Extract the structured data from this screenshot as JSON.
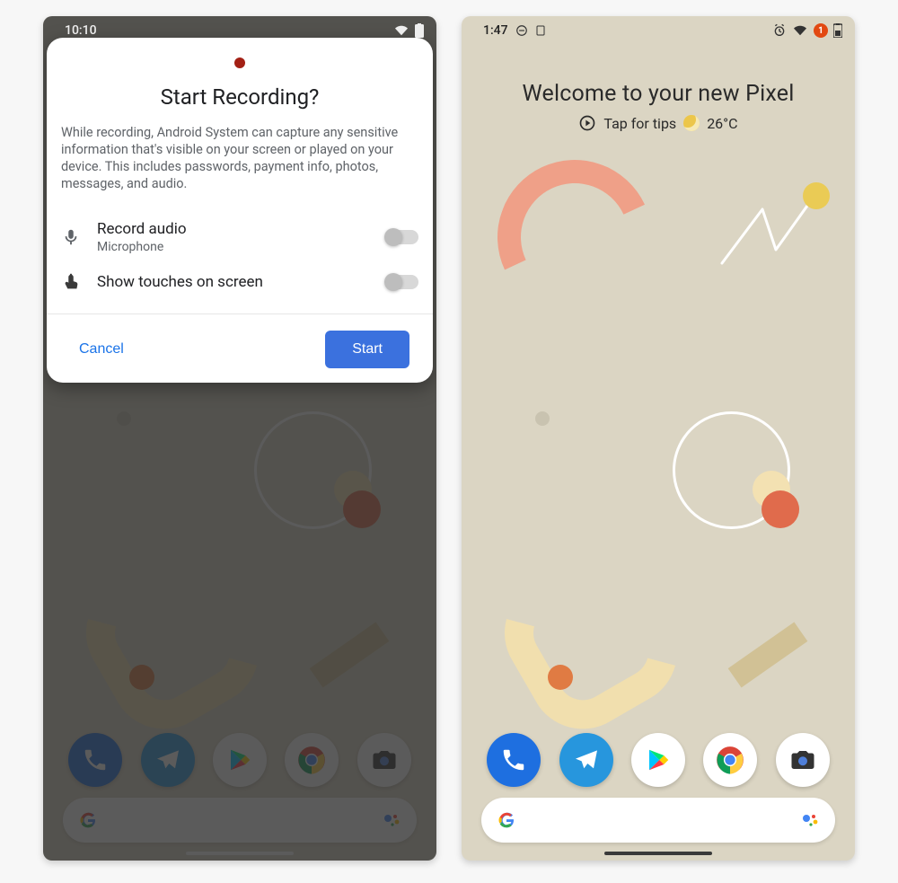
{
  "left": {
    "status": {
      "time": "10:10"
    },
    "dialog": {
      "title": "Start Recording?",
      "description": "While recording, Android System can capture any sensitive information that's visible on your screen or played on your device. This includes passwords, payment info, photos, messages, and audio.",
      "options": {
        "record_audio": {
          "title": "Record audio",
          "subtitle": "Microphone",
          "enabled": false
        },
        "show_touches": {
          "title": "Show touches on screen",
          "enabled": false
        }
      },
      "actions": {
        "cancel": "Cancel",
        "start": "Start"
      }
    }
  },
  "right": {
    "status": {
      "time": "1:47",
      "notification_count": "1"
    },
    "widget": {
      "headline": "Welcome to your new Pixel",
      "tips_label": "Tap for tips",
      "temp": "26°C"
    }
  },
  "dock": {
    "apps": [
      "phone",
      "telegram",
      "play-store",
      "chrome",
      "camera"
    ]
  }
}
